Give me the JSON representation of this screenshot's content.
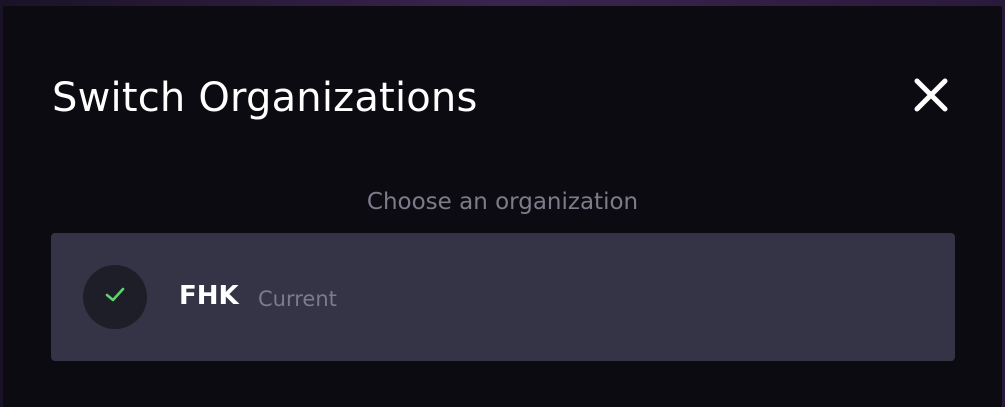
{
  "modal": {
    "title": "Switch Organizations",
    "close_icon": "close-icon",
    "subtitle": "Choose an organization"
  },
  "organizations": [
    {
      "name": "FHK",
      "status": "Current",
      "icon": "check-icon",
      "check_color": "#5bd66b"
    }
  ],
  "colors": {
    "modal_background": "#0c0b12",
    "row_background": "#353446",
    "muted_text": "#7d7b89"
  }
}
